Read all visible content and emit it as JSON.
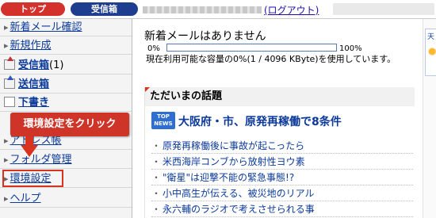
{
  "header": {
    "tabs": [
      {
        "label": "トップ"
      },
      {
        "label": "受信箱"
      }
    ],
    "logout_text": "(ログアウト)"
  },
  "sidebar": {
    "items": [
      {
        "label": "新着メール確認",
        "icon": "arrow-icon"
      },
      {
        "label": "新規作成",
        "icon": "arrow-icon"
      },
      {
        "label": "受信箱",
        "count": "(1)",
        "icon": "inbox-icon"
      },
      {
        "label": "送信箱",
        "icon": "sent-icon"
      },
      {
        "label": "下書き",
        "icon": "draft-icon"
      },
      {
        "label": "アドレス帳",
        "icon": "arrow-icon"
      },
      {
        "label": "フォルダ管理",
        "icon": "arrow-icon"
      },
      {
        "label": "環境設定",
        "icon": "arrow-icon"
      },
      {
        "label": "ヘルプ",
        "icon": "arrow-icon"
      }
    ]
  },
  "callout": {
    "text": "環境設定をクリック"
  },
  "main": {
    "no_mail": "新着メールはありません",
    "quota": {
      "min_label": "0%",
      "max_label": "100%",
      "used_fraction": 0,
      "usage_text": "現在利用可能な容量の0%(1 / 4096 KByte)を使用しています。"
    },
    "topics": {
      "heading": "ただいまの話題",
      "badge": "TOP NEWS",
      "headline": "大阪府・市、原発再稼働で8条件",
      "items": [
        "原発再稼働後に事故が起こったら",
        "米西海岸コンブから放射性ヨウ素",
        "\"衛星\"は迎撃不能の緊急事態!?",
        "小中高生が伝える、被災地のリアル",
        "永六輔のラジオで考えさせられる事"
      ]
    }
  },
  "right": {
    "text": "天"
  },
  "colors": {
    "accent_red": "#d4312c",
    "nav_blue": "#1f3d8f",
    "link_blue": "#0b3a9a"
  }
}
